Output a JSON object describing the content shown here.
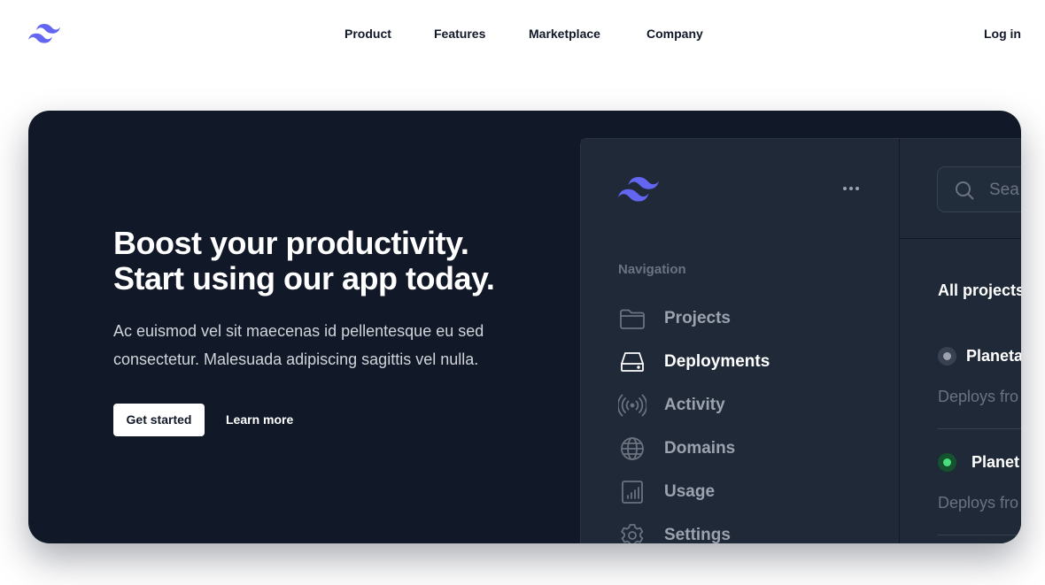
{
  "header": {
    "logo": "tailwind-logo",
    "nav": [
      "Product",
      "Features",
      "Marketplace",
      "Company"
    ],
    "login_label": "Log in"
  },
  "hero": {
    "title_line1": "Boost your productivity.",
    "title_line2": "Start using our app today.",
    "description": "Ac euismod vel sit maecenas id pellentesque eu sed consectetur. Malesuada adipiscing sagittis vel nulla.",
    "primary_cta": "Get started",
    "secondary_cta": "Learn more"
  },
  "app_preview": {
    "sidebar": {
      "logo": "tailwind-logo",
      "more_icon": "ellipsis-icon",
      "heading": "Navigation",
      "items": [
        {
          "label": "Projects",
          "icon": "folder-icon",
          "active": false
        },
        {
          "label": "Deployments",
          "icon": "server-icon",
          "active": true
        },
        {
          "label": "Activity",
          "icon": "signal-icon",
          "active": false
        },
        {
          "label": "Domains",
          "icon": "globe-icon",
          "active": false
        },
        {
          "label": "Usage",
          "icon": "chart-bar-icon",
          "active": false
        },
        {
          "label": "Settings",
          "icon": "gear-icon",
          "active": false
        }
      ]
    },
    "main": {
      "search_placeholder": "Sea",
      "heading": "All projects",
      "projects": [
        {
          "name": "Planeta",
          "subtitle": "Deploys fro",
          "status": "gray"
        },
        {
          "name": "Planet",
          "subtitle": "Deploys fro",
          "status": "green"
        }
      ]
    }
  },
  "colors": {
    "brand_indigo": "#6366f1",
    "hero_bg": "#111827",
    "app_bg": "#1f2937",
    "status_green": "#4ade80"
  }
}
